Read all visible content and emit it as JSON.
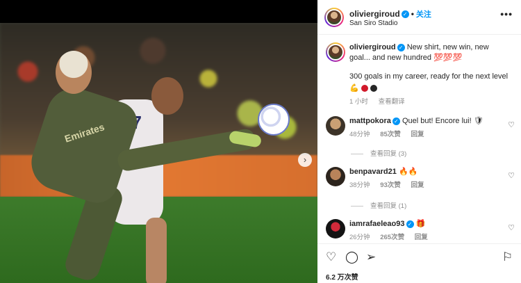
{
  "post": {
    "username": "oliviergiroud",
    "follow_label": "关注",
    "location": "San Siro Stadio",
    "more": "•••",
    "photo": {
      "jersey_number": "17",
      "sponsor": "Emirates"
    },
    "caption": {
      "username": "oliviergiroud",
      "text1": "New shirt, new win, new goal... and new hundred",
      "text2": "300 goals in my career, ready for the next level",
      "time": "1 小时",
      "translate": "查看翻译"
    }
  },
  "comments": [
    {
      "username": "mattpokora",
      "text": "Quel but! Encore lui!",
      "time": "48分钟",
      "likes": "85次赞",
      "reply": "回复",
      "view_replies": "查看回复 (3)"
    },
    {
      "username": "benpavard21",
      "text": "",
      "time": "38分钟",
      "likes": "93次赞",
      "reply": "回复",
      "view_replies": "查看回复 (1)"
    },
    {
      "username": "iamrafaeleao93",
      "text": "",
      "time": "26分钟",
      "likes": "265次赞",
      "reply": "回复"
    }
  ],
  "actions": {
    "like_count": "6.2 万次赞"
  },
  "icons": {
    "like": "heart-icon",
    "comment": "comment-icon",
    "share": "share-icon",
    "save": "bookmark-icon",
    "verified": "verified-badge-icon",
    "next": "chevron-right-icon"
  },
  "colors": {
    "accent": "#0095f6",
    "muted": "#8e8e8e",
    "text": "#262626"
  }
}
